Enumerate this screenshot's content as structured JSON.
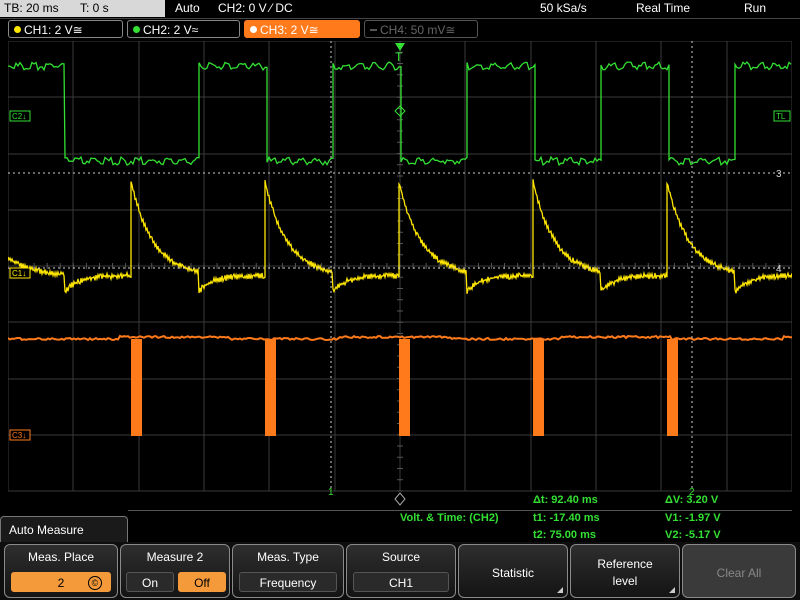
{
  "topbar": {
    "timebase": "TB: 20 ms",
    "trigger_pos": "T: 0 s",
    "trigger_mode": "Auto",
    "trigger_info": "CH2: 0 V ⁄ DC",
    "sample_rate": "50 kSa/s",
    "acq_mode": "Real Time",
    "run_state": "Run"
  },
  "channels": [
    {
      "label": "CH1: 2 V≅",
      "color": "#ffe600",
      "state": "on"
    },
    {
      "label": "CH2: 2 V≈",
      "color": "#33e033",
      "state": "on"
    },
    {
      "label": "CH3: 2 V≅",
      "color": "#ff7a1a",
      "state": "active"
    },
    {
      "label": "CH4: 50 mV≅",
      "color": "#666666",
      "state": "off"
    }
  ],
  "markers": {
    "c2": "C2↓",
    "c1": "C1↓",
    "c3": "C3↓",
    "tl": "TL",
    "cursor_3": "3",
    "cursor_4": "4",
    "cursor_1": "1",
    "cursor_2": "2",
    "trigger": "T"
  },
  "readout": {
    "dt": "Δt: 92.40 ms",
    "dv": "ΔV: 3.20 V",
    "mode": "Volt. & Time: (CH2)",
    "t1": "t1: -17.40 ms",
    "v1": "V1: -1.97 V",
    "t2": "t2: 75.00 ms",
    "v2": "V2: -5.17 V"
  },
  "auto_measure": {
    "tab_label": "Auto Measure"
  },
  "softkeys": {
    "meas_place": {
      "title": "Meas. Place",
      "value": "2",
      "icon": "copy-icon"
    },
    "measure2": {
      "title": "Measure 2",
      "on": "On",
      "off": "Off",
      "selected": "Off"
    },
    "meas_type": {
      "title": "Meas. Type",
      "value": "Frequency"
    },
    "source": {
      "title": "Source",
      "value": "CH1"
    },
    "statistic": {
      "label": "Statistic"
    },
    "reference": {
      "line1": "Reference",
      "line2": "level"
    },
    "clear_all": {
      "label": "Clear All"
    }
  },
  "colors": {
    "ch1": "#ffe600",
    "ch2": "#33e033",
    "ch3": "#ff7a1a",
    "grid": "#3a3a3a",
    "readout": "#33e033",
    "accent": "#f59a3a"
  }
}
